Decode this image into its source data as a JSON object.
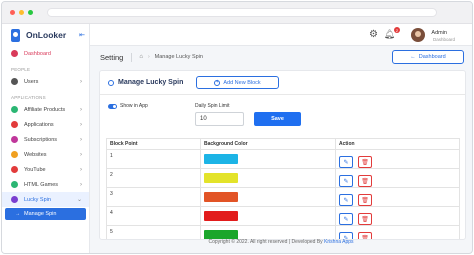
{
  "app": {
    "name": "OnLooker"
  },
  "sidebar": {
    "dashboard": "Dashboard",
    "section_people": "PEOPLE",
    "users": "Users",
    "section_apps": "APPLICATIONS",
    "items": [
      {
        "label": "Affiliate Products",
        "color": "#2bb673"
      },
      {
        "label": "Applications",
        "color": "#e23b3b"
      },
      {
        "label": "Subscriptions",
        "color": "#c0379b"
      },
      {
        "label": "Websites",
        "color": "#f0a020"
      },
      {
        "label": "YouTube",
        "color": "#e23b3b"
      },
      {
        "label": "HTML Games",
        "color": "#2bb673"
      },
      {
        "label": "Lucky Spin",
        "color": "#7a3fd0"
      }
    ],
    "sub_item": "Manage Spin"
  },
  "topbar": {
    "notification_count": "2",
    "user_name": "Admin",
    "user_role": "Dashboard"
  },
  "page": {
    "title": "Setting",
    "breadcrumb": "Manage Lucky Spin",
    "back_button": "Dashboard"
  },
  "card": {
    "title": "Manage Lucky Spin",
    "add_button": "Add New Block",
    "show_in_app": "Show in App",
    "limit_label": "Daily Spin Limit",
    "limit_value": "10",
    "save_button": "Save"
  },
  "table": {
    "headers": [
      "Block Point",
      "Background Color",
      "Action"
    ],
    "rows": [
      {
        "point": "1",
        "color": "#1cb4e6"
      },
      {
        "point": "2",
        "color": "#e3e32a"
      },
      {
        "point": "3",
        "color": "#e25426"
      },
      {
        "point": "4",
        "color": "#e21c1c"
      },
      {
        "point": "5",
        "color": "#1ba62b"
      }
    ]
  },
  "footer": {
    "text": "Copyright © 2022. All right reserved | Developed By",
    "company": "Krishna Apps"
  },
  "colors": {
    "primary": "#2b6fe0",
    "danger": "#e23b3b"
  }
}
